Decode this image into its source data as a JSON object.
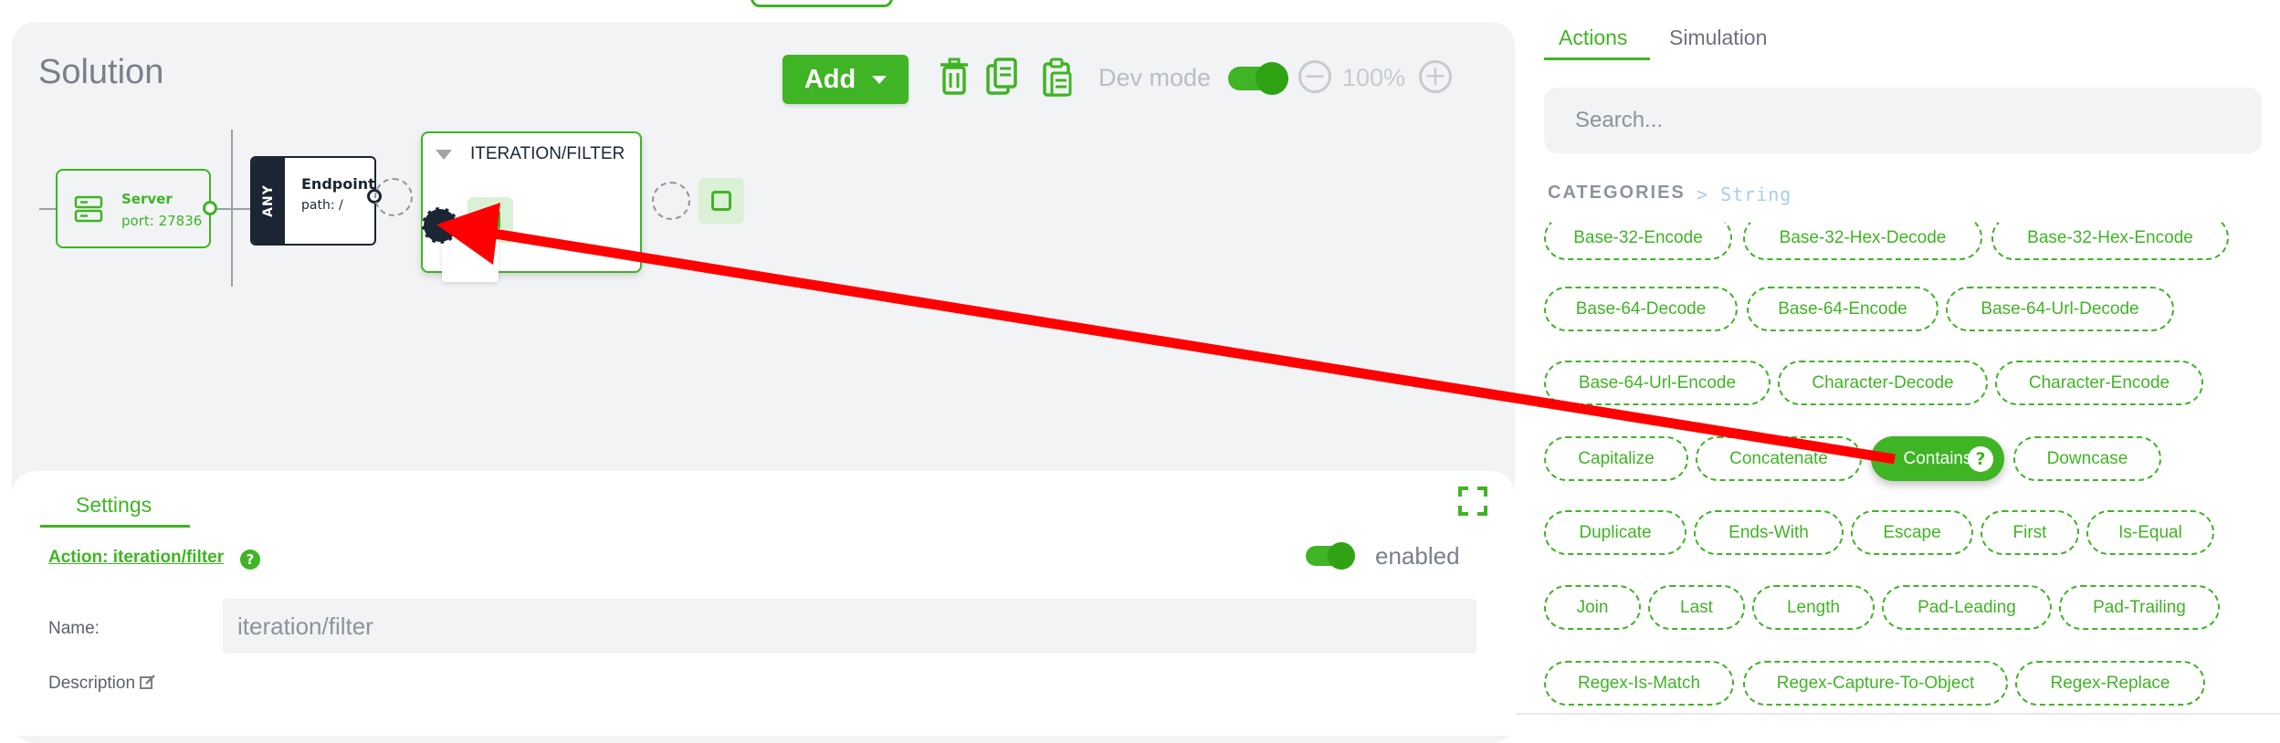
{
  "canvas": {
    "title": "Solution",
    "add_label": "Add",
    "dev_mode_label": "Dev mode",
    "zoom_value": "100%",
    "zoom_minus": "−",
    "zoom_plus": "+",
    "icons": [
      "trash-icon",
      "copy-icon",
      "paste-icon",
      "caret-down-icon",
      "minus-icon",
      "plus-icon"
    ]
  },
  "flow": {
    "server": {
      "title": "Server",
      "port": "port: 27836"
    },
    "endpoint": {
      "method": "ANY",
      "title": "Endpoint",
      "path": "path: /"
    },
    "iteration": {
      "title": "ITERATION/FILTER"
    }
  },
  "settings": {
    "tab": "Settings",
    "action_link": "Action: iteration/filter",
    "help": "?",
    "enabled_label": "enabled",
    "name_label": "Name:",
    "name_value": "iteration/filter",
    "description_label": "Description"
  },
  "sidebar": {
    "tabs": {
      "actions": "Actions",
      "simulation": "Simulation"
    },
    "search_placeholder": "Search...",
    "categories_label": "CATEGORIES",
    "breadcrumb": "> String",
    "chips": [
      "Base-32-Encode",
      "Base-32-Hex-Decode",
      "Base-32-Hex-Encode",
      "Base-64-Decode",
      "Base-64-Encode",
      "Base-64-Url-Decode",
      "Base-64-Url-Encode",
      "Character-Decode",
      "Character-Encode",
      "Capitalize",
      "Concatenate",
      "Contains",
      "Downcase",
      "Duplicate",
      "Ends-With",
      "Escape",
      "First",
      "Is-Equal",
      "Join",
      "Last",
      "Length",
      "Pad-Leading",
      "Pad-Trailing",
      "Regex-Is-Match",
      "Regex-Capture-To-Object",
      "Regex-Replace"
    ],
    "dragging_chip": "Contains"
  },
  "colors": {
    "accent": "#3fb424",
    "dark": "#1b2533",
    "arrow": "#ff0000"
  }
}
